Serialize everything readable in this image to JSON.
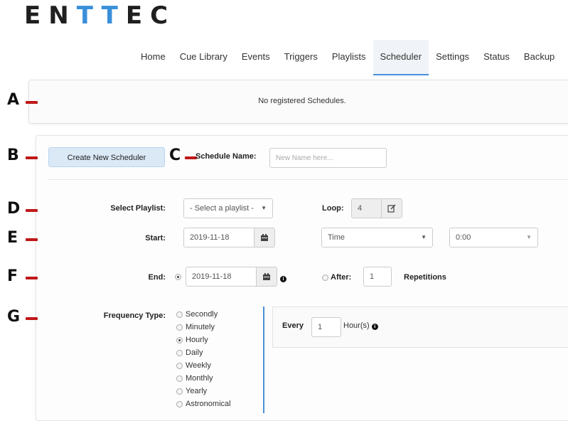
{
  "brand": {
    "logo_parts": [
      "EN",
      "TT",
      "EC"
    ]
  },
  "nav": {
    "items": [
      "Home",
      "Cue Library",
      "Events",
      "Triggers",
      "Playlists",
      "Scheduler",
      "Settings",
      "Status",
      "Backup"
    ],
    "active": "Scheduler"
  },
  "schedules": {
    "empty_message": "No registered Schedules."
  },
  "markers": [
    "A",
    "B",
    "C",
    "D",
    "E",
    "F",
    "G"
  ],
  "form": {
    "create_button": "Create New Scheduler",
    "schedule_name_label": "Schedule Name:",
    "schedule_name_placeholder": "New Name here...",
    "playlist_label": "Select Playlist:",
    "playlist_value": "- Select a playlist -",
    "loop_label": "Loop:",
    "loop_value": "4",
    "start_label": "Start:",
    "start_date": "2019-11-18",
    "start_time_mode": "Time",
    "start_time_value": "0:00",
    "end_label": "End:",
    "end_date": "2019-11-18",
    "after_label": "After:",
    "after_value": "1",
    "repetitions_label": "Repetitions",
    "frequency_label": "Frequency Type:",
    "frequency_options": [
      "Secondly",
      "Minutely",
      "Hourly",
      "Daily",
      "Weekly",
      "Monthly",
      "Yearly",
      "Astronomical"
    ],
    "frequency_selected": "Hourly",
    "every_label": "Every",
    "every_value": "1",
    "every_unit": "Hour(s)"
  },
  "colors": {
    "accent": "#4a90d9",
    "marker_dash": "#c01818",
    "logo_t": "#3a8fd9"
  }
}
